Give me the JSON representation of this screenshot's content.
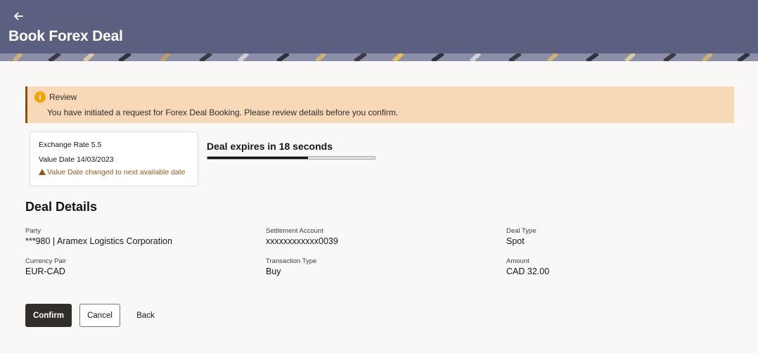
{
  "header": {
    "title": "Book Forex Deal"
  },
  "banner": {
    "title": "Review",
    "message": "You have initiated a request for Forex Deal Booking. Please review details before you confirm."
  },
  "rate_card": {
    "exchange_rate": "Exchange Rate 5.5",
    "value_date": "Value Date 14/03/2023",
    "warning": "Value Date changed to next available date"
  },
  "expiry": {
    "text": "Deal expires in 18 seconds",
    "progress_fraction": 0.6
  },
  "details": {
    "title": "Deal Details",
    "fields": [
      {
        "label": "Party",
        "value": "***980 | Aramex Logistics Corporation"
      },
      {
        "label": "Settlement Account",
        "value": "xxxxxxxxxxxx0039"
      },
      {
        "label": "Deal Type",
        "value": "Spot"
      },
      {
        "label": "Currency Pair",
        "value": "EUR-CAD"
      },
      {
        "label": "Transaction Type",
        "value": "Buy"
      },
      {
        "label": "Amount",
        "value": "CAD 32.00"
      }
    ]
  },
  "actions": {
    "confirm": "Confirm",
    "cancel": "Cancel",
    "back": "Back"
  },
  "colors": {
    "header": "#5b5f80",
    "banner": "#f7d9b8",
    "warning": "#8c5b1c",
    "primary_button": "#312d2a"
  }
}
